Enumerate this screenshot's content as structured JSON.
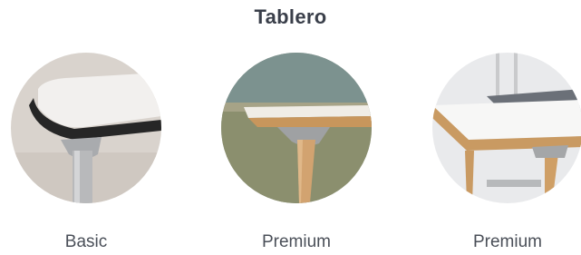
{
  "section": {
    "title": "Tablero"
  },
  "options": [
    {
      "label": "Basic",
      "image": "table-edge-basic-photo"
    },
    {
      "label": "Premium",
      "image": "table-edge-premium-wood-photo"
    },
    {
      "label": "Premium",
      "image": "table-corner-premium-wood-photo"
    }
  ],
  "colors": {
    "title": "#3a3f4a",
    "label": "#4a4f58",
    "edge_basic": "#2a2a2a",
    "edge_wood": "#c8965c",
    "metal": "#b8b9bb"
  }
}
